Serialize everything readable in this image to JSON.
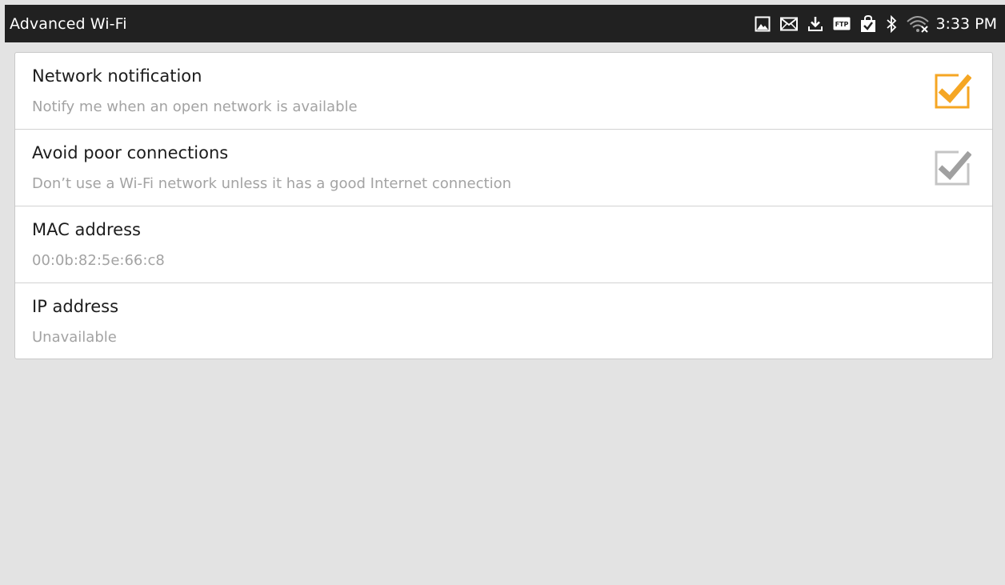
{
  "status_bar": {
    "title": "Advanced Wi-Fi",
    "time": "3:33 PM",
    "icons": [
      "image-icon",
      "email-icon",
      "download-icon",
      "ftp-icon",
      "shopping-bag-icon",
      "bluetooth-icon",
      "wifi-icon"
    ],
    "ftp_label": "FTP"
  },
  "settings": [
    {
      "title": "Network notification",
      "summary": "Notify me when an open network is available",
      "checked": true,
      "enabled": true,
      "accent": "#f5a623"
    },
    {
      "title": "Avoid poor connections",
      "summary": "Don’t use a Wi-Fi network unless it has a good Internet connection",
      "checked": true,
      "enabled": false,
      "accent": "#a0a0a0"
    },
    {
      "title": "MAC address",
      "summary": "00:0b:82:5e:66:c8"
    },
    {
      "title": "IP address",
      "summary": "Unavailable"
    }
  ],
  "colors": {
    "status_bar_bg": "#212121",
    "page_bg": "#e3e3e3",
    "checkbox_accent": "#f5a623"
  }
}
